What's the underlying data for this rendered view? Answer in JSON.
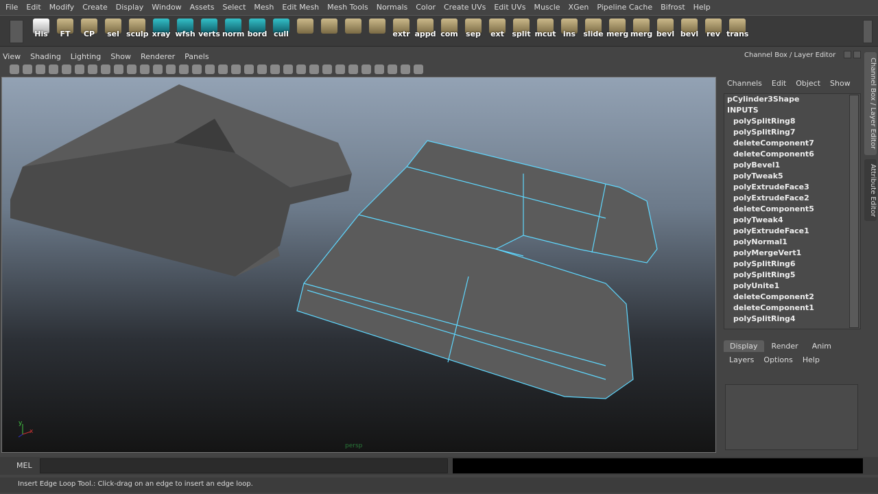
{
  "menubar": [
    "File",
    "Edit",
    "Modify",
    "Create",
    "Display",
    "Window",
    "Assets",
    "Select",
    "Mesh",
    "Edit Mesh",
    "Mesh Tools",
    "Normals",
    "Color",
    "Create UVs",
    "Edit UVs",
    "Muscle",
    "XGen",
    "Pipeline Cache",
    "Bifrost",
    "Help"
  ],
  "shelf": [
    {
      "label": "His",
      "icon": "pencil-icon"
    },
    {
      "label": "FT",
      "icon": "axes-icon"
    },
    {
      "label": "CP",
      "icon": "axes-icon"
    },
    {
      "label": "sel",
      "icon": "brush-icon"
    },
    {
      "label": "sculp",
      "icon": "sculpt-icon"
    },
    {
      "label": "xray",
      "icon": "shader-icon"
    },
    {
      "label": "wfsh",
      "icon": "shader-icon"
    },
    {
      "label": "verts",
      "icon": "shader-icon"
    },
    {
      "label": "norm",
      "icon": "shader-icon"
    },
    {
      "label": "bord",
      "icon": "shader-icon"
    },
    {
      "label": "cull",
      "icon": "shader-icon"
    },
    {
      "label": "",
      "icon": "poly-plane-icon"
    },
    {
      "label": "",
      "icon": "poly-cube-icon"
    },
    {
      "label": "",
      "icon": "poly-sphere-icon"
    },
    {
      "label": "",
      "icon": "poly-cylinder-icon"
    },
    {
      "label": "extr",
      "icon": "extrude-icon"
    },
    {
      "label": "appd",
      "icon": "append-icon"
    },
    {
      "label": "com",
      "icon": "combine-icon"
    },
    {
      "label": "sep",
      "icon": "separate-icon"
    },
    {
      "label": "ext",
      "icon": "extract-icon"
    },
    {
      "label": "split",
      "icon": "split-icon"
    },
    {
      "label": "mcut",
      "icon": "multicut-icon"
    },
    {
      "label": "ins",
      "icon": "insert-loop-icon"
    },
    {
      "label": "slide",
      "icon": "slide-icon"
    },
    {
      "label": "merg",
      "icon": "merge-icon"
    },
    {
      "label": "merg",
      "icon": "merge-icon"
    },
    {
      "label": "bevl",
      "icon": "bevel-icon"
    },
    {
      "label": "bevl",
      "icon": "bevel-icon"
    },
    {
      "label": "rev",
      "icon": "reverse-icon"
    },
    {
      "label": "trans",
      "icon": "transform-icon"
    }
  ],
  "viewport": {
    "menu": [
      "View",
      "Shading",
      "Lighting",
      "Show",
      "Renderer",
      "Panels"
    ],
    "camera": "persp",
    "axis": {
      "y": "y",
      "x": "x"
    }
  },
  "channel_box": {
    "title": "Channel Box / Layer Editor",
    "menu": [
      "Channels",
      "Edit",
      "Object",
      "Show"
    ],
    "shape": "pCylinder3Shape",
    "inputs_label": "INPUTS",
    "inputs": [
      "polySplitRing8",
      "polySplitRing7",
      "deleteComponent7",
      "deleteComponent6",
      "polyBevel1",
      "polyTweak5",
      "polyExtrudeFace3",
      "polyExtrudeFace2",
      "deleteComponent5",
      "polyTweak4",
      "polyExtrudeFace1",
      "polyNormal1",
      "polyMergeVert1",
      "polySplitRing6",
      "polySplitRing5",
      "polyUnite1",
      "deleteComponent2",
      "deleteComponent1",
      "polySplitRing4"
    ]
  },
  "layer_editor": {
    "tabs": [
      "Display",
      "Render",
      "Anim"
    ],
    "active_tab": "Display",
    "menu": [
      "Layers",
      "Options",
      "Help"
    ]
  },
  "side_tabs": [
    "Channel Box / Layer Editor",
    "Attribute Editor"
  ],
  "command_line": {
    "label": "MEL",
    "value": ""
  },
  "status": "Insert Edge Loop Tool.: Click-drag on an edge to insert an edge loop.",
  "colors": {
    "wire": "#5fd8ff",
    "accent": "#5a8bb5"
  }
}
